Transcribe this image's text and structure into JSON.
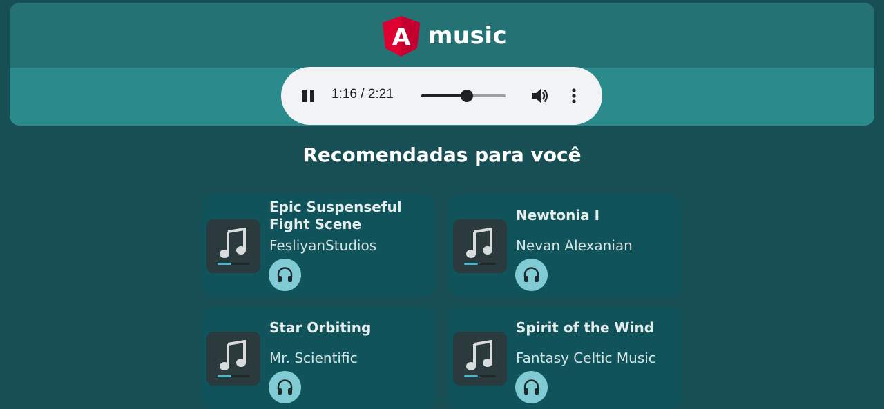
{
  "header": {
    "logo_letter": "A",
    "app_name": "music"
  },
  "player": {
    "time_display": "1:16 / 2:21",
    "progress_fraction": 0.539
  },
  "section": {
    "title": "Recomendadas para você"
  },
  "songs": [
    {
      "title": "Epic Suspenseful Fight Scene",
      "artist": "FesliyanStudios",
      "icon": "music-note-icon"
    },
    {
      "title": "Newtonia I",
      "artist": "Nevan Alexanian",
      "icon": "music-note-icon"
    },
    {
      "title": "Star Orbiting",
      "artist": "Mr. Scientific",
      "icon": "music-note-icon"
    },
    {
      "title": "Spirit of the Wind",
      "artist": "Fantasy Celtic Music",
      "icon": "music-note-icon"
    }
  ],
  "colors": {
    "background": "#174f54",
    "header": "#257274",
    "card": "#10535a",
    "listen_button": "#80cbd4",
    "logo_red": "#dd0031"
  }
}
